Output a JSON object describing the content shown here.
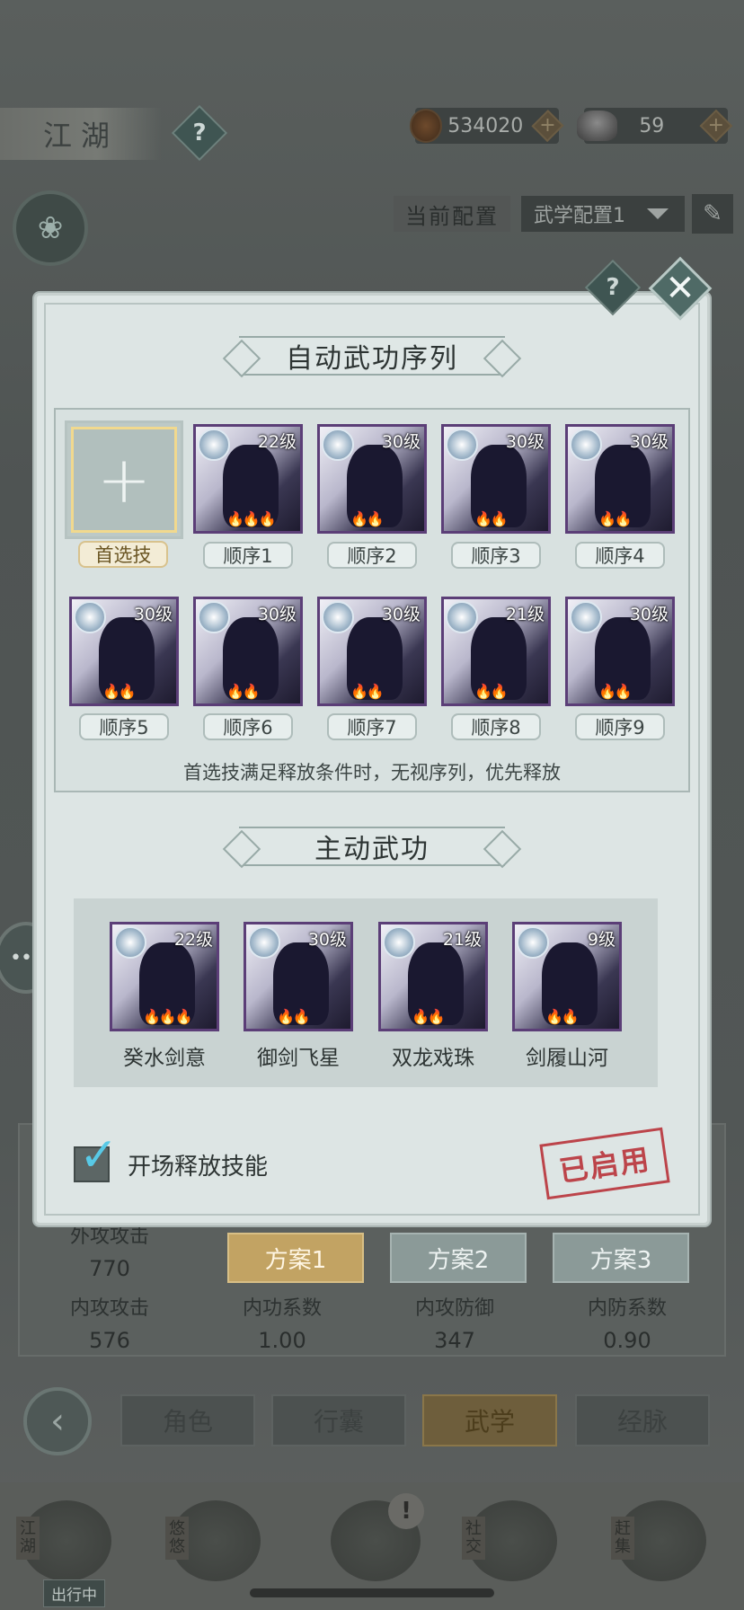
{
  "header": {
    "title": "江湖",
    "help": "?",
    "coins": "534020",
    "ingots": "59",
    "plus": "+"
  },
  "config": {
    "label": "当前配置",
    "selected": "武学配置1",
    "edit_icon": "✎"
  },
  "modal": {
    "help": "?",
    "close": "✕",
    "sequence_title": "自动武功序列",
    "preferred_plus": "+",
    "preferred_label": "首选技",
    "sequence": [
      {
        "level": "22级",
        "order": "顺序1",
        "flames": "🔥🔥🔥"
      },
      {
        "level": "30级",
        "order": "顺序2",
        "flames": "🔥🔥"
      },
      {
        "level": "30级",
        "order": "顺序3",
        "flames": "🔥🔥"
      },
      {
        "level": "30级",
        "order": "顺序4",
        "flames": "🔥🔥"
      },
      {
        "level": "30级",
        "order": "顺序5",
        "flames": "🔥🔥"
      },
      {
        "level": "30级",
        "order": "顺序6",
        "flames": "🔥🔥"
      },
      {
        "level": "30级",
        "order": "顺序7",
        "flames": "🔥🔥"
      },
      {
        "level": "21级",
        "order": "顺序8",
        "flames": "🔥🔥"
      },
      {
        "level": "30级",
        "order": "顺序9",
        "flames": "🔥🔥"
      }
    ],
    "hint": "首选技满足释放条件时，无视序列，优先释放",
    "active_title": "主动武功",
    "active_skills": [
      {
        "level": "22级",
        "name": "癸水剑意",
        "flames": "🔥🔥🔥"
      },
      {
        "level": "30级",
        "name": "御剑飞星",
        "flames": "🔥🔥"
      },
      {
        "level": "21级",
        "name": "双龙戏珠",
        "flames": "🔥🔥"
      },
      {
        "level": "9级",
        "name": "剑履山河",
        "flames": "🔥🔥"
      }
    ],
    "checkbox_label": "开场释放技能",
    "checked": true,
    "stamp": "已启用"
  },
  "stats": {
    "row1": [
      {
        "label": "外攻攻击",
        "value": "770"
      }
    ],
    "row2": [
      {
        "label": "内攻攻击",
        "value": "576"
      },
      {
        "label": "内功系数",
        "value": "1.00"
      },
      {
        "label": "内攻防御",
        "value": "347"
      },
      {
        "label": "内防系数",
        "value": "0.90"
      }
    ],
    "plans": [
      "方案1",
      "方案2",
      "方案3"
    ],
    "active_plan": "方案1"
  },
  "nav": {
    "back": "‹",
    "tabs": [
      "角色",
      "行囊",
      "武学",
      "经脉"
    ],
    "active_tab": "武学"
  },
  "bottom": {
    "items": [
      "江湖",
      "悠悠",
      "社交",
      "赶集"
    ],
    "status": "出行中",
    "badge": "!"
  },
  "chat": "•••",
  "colors": {
    "modal_bg": "#dde5e4",
    "active_plan": "#c2a363",
    "stamp_red": "#b9333a",
    "card_border": "#5b3e77",
    "check_blue": "#58c9e6"
  }
}
